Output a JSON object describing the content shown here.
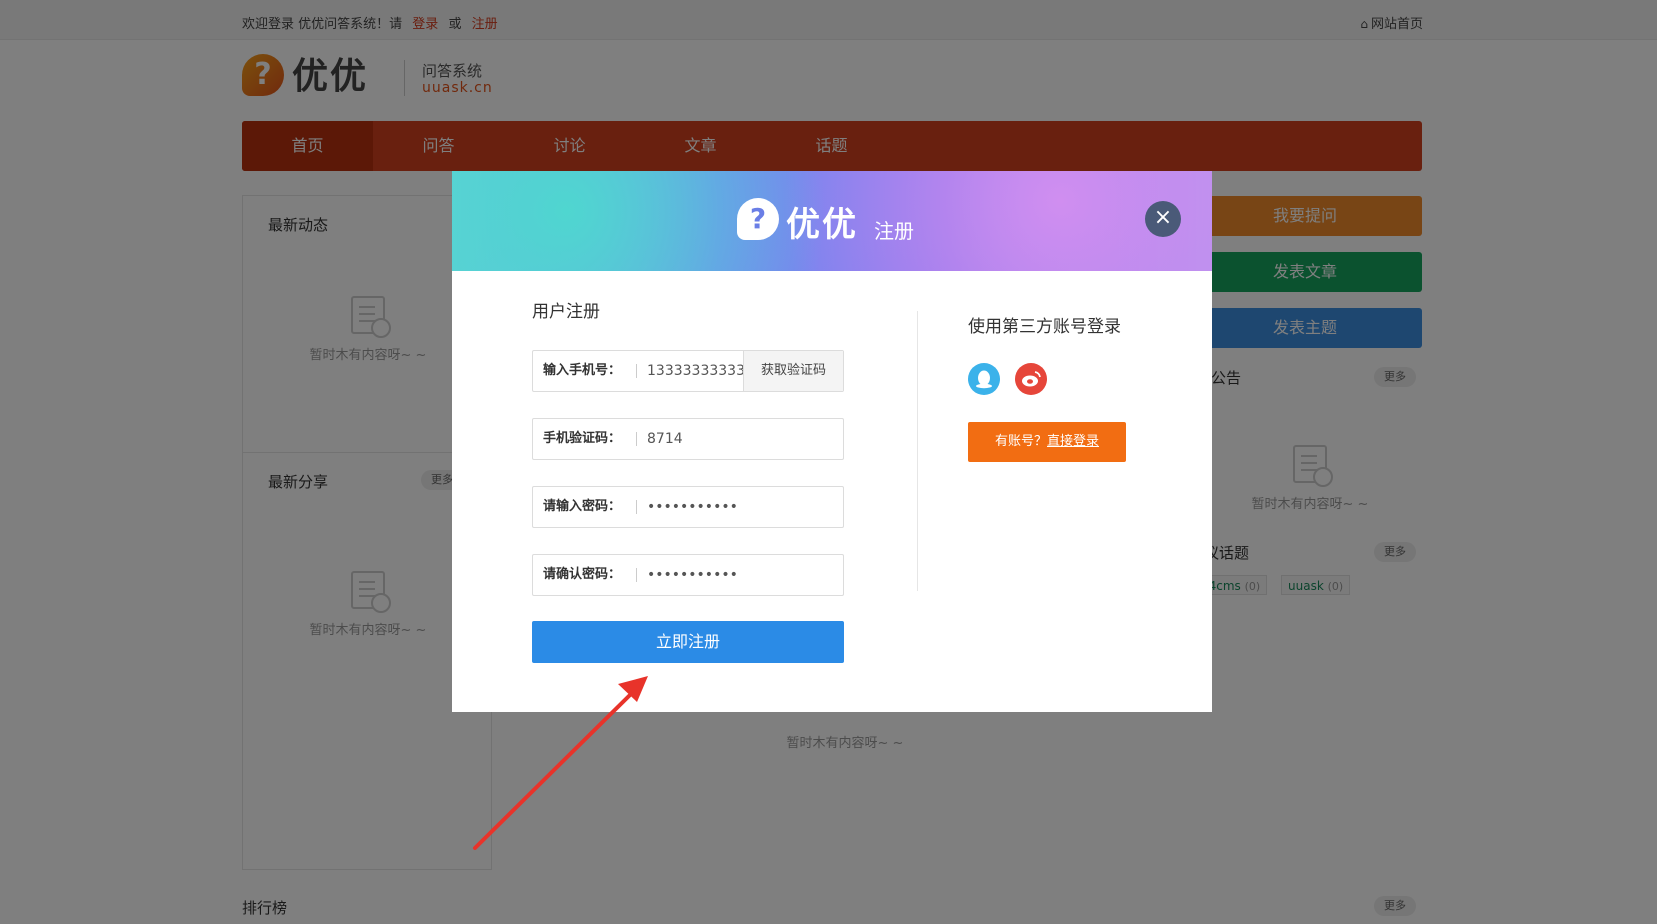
{
  "topbar": {
    "welcome": "欢迎登录 优优问答系统！请",
    "login": "登录",
    "or": "或",
    "register": "注册",
    "home": "网站首页"
  },
  "logo": {
    "brand": "优优",
    "system": "问答系统",
    "domain": "uuask.cn"
  },
  "nav": [
    "首页",
    "问答",
    "讨论",
    "文章",
    "话题"
  ],
  "left": {
    "latest_activity": "最新动态",
    "latest_share": "最新分享",
    "more": "更多",
    "empty": "暂时木有内容呀~ ~",
    "ranking": "排行榜"
  },
  "right": {
    "ask": "我要提问",
    "post_article": "发表文章",
    "post_topic": "发表主题",
    "notice": "站公告",
    "hot_topics": "议话题",
    "more": "更多",
    "empty": "暂时木有内容呀~ ~",
    "tags": [
      {
        "name": "74cms",
        "count": "(0)"
      },
      {
        "name": "uuask",
        "count": "(0)"
      }
    ]
  },
  "center": {
    "empty": "暂时木有内容呀~ ~"
  },
  "modal": {
    "brand": "优优",
    "title": "注册",
    "close": "×",
    "form_title": "用户注册",
    "fields": [
      {
        "label": "输入手机号：",
        "value": "13333333333",
        "action": "获取验证码"
      },
      {
        "label": "手机验证码：",
        "value": "8714"
      },
      {
        "label": "请输入密码：",
        "value": "•••••••••••"
      },
      {
        "label": "请确认密码：",
        "value": "•••••••••••"
      }
    ],
    "submit": "立即注册",
    "third_party_title": "使用第三方账号登录",
    "login_prefix": "有账号？",
    "login_link": "直接登录"
  },
  "colors": {
    "nav": "#d2401e",
    "submit": "#2b8be6",
    "login": "#f26d12",
    "qq": "#3bb2ea",
    "weibo": "#e6463a"
  }
}
